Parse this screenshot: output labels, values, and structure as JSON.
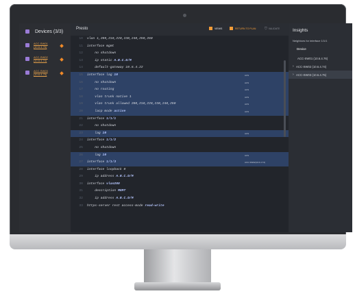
{
  "devices": {
    "title": "Devices (3/3)",
    "items": [
      {
        "name": "ACC-SW01",
        "ip": "(10.6.4.76)"
      },
      {
        "name": "ACC-SW02",
        "ip": "(10.6.4.74)"
      },
      {
        "name": "ACC-SW03",
        "ip": "(10.6.4.75)"
      }
    ]
  },
  "editor": {
    "title": "Presto",
    "views_label": "VIEWS",
    "return_label": "RETURN TO PLAN",
    "validate_label": "VALIDATE",
    "lines": [
      {
        "n": "10",
        "t": "vlan 1,209,210,220,230,240,250,260"
      },
      {
        "n": "11",
        "t": "interface mgmt"
      },
      {
        "n": "12",
        "t": "    no shutdown"
      },
      {
        "n": "13",
        "t": "    ip static ",
        "b": "A.B.C.D/M"
      },
      {
        "n": "14",
        "t": "    default-gateway 10.6.4.22"
      },
      {
        "n": "15",
        "t": "interface lag ",
        "b": "10",
        "hl": true,
        "a": "ACS"
      },
      {
        "n": "16",
        "t": "    no shutdown",
        "hl": true,
        "a": "ACS"
      },
      {
        "n": "17",
        "t": "    no routing",
        "hl": true,
        "a": "ACS"
      },
      {
        "n": "18",
        "t": "    vlan trunk native 1",
        "hl": true,
        "a": "ACS"
      },
      {
        "n": "19",
        "t": "    vlan trunk allowed 200,210,220,230,240,250",
        "hl": true,
        "a": "ACS"
      },
      {
        "n": "20",
        "t": "    lacp mode ",
        "b": "active",
        "hl": true,
        "a": "ACS"
      },
      {
        "n": "21",
        "t": "interface ",
        "b": "1/1/1"
      },
      {
        "n": "22",
        "t": "    no shutdown"
      },
      {
        "n": "23",
        "t": "    lag ",
        "b": "10",
        "hl": true,
        "a": "ACS"
      },
      {
        "n": "24",
        "t": "interface ",
        "b": "1/1/2"
      },
      {
        "n": "25",
        "t": "    no shutdown"
      },
      {
        "n": "26",
        "t": "    lag ",
        "b": "10",
        "hl": true,
        "a": "ACS"
      },
      {
        "n": "27",
        "t": "interface ",
        "b": "1/1/3",
        "hl": true,
        "a": "ACC-SW02(10.6.4.74)"
      },
      {
        "n": "28",
        "t": "interface loopback 0"
      },
      {
        "n": "29",
        "t": "    ip address ",
        "b": "A.B.C.D/M"
      },
      {
        "n": "30",
        "t": "interface ",
        "b": "vlan200"
      },
      {
        "n": "31",
        "t": "    description ",
        "b": "MGMT"
      },
      {
        "n": "32",
        "t": "    ip address ",
        "b": "A.B.C.D/M"
      },
      {
        "n": "33",
        "t": "https-server rest access-mode ",
        "b": "read-write"
      }
    ]
  },
  "insights": {
    "title": "Insights",
    "subtitle": "Neighbors for interface 1/1/1",
    "device_header": "Device",
    "rows": [
      {
        "label": "ACC-SW01 (10.6.4.76)",
        "chevron": false,
        "active": false
      },
      {
        "label": "ACC-SW02 (10.6.4.74)",
        "chevron": true,
        "active": false
      },
      {
        "label": "ACC-SW03 (10.6.4.75)",
        "chevron": true,
        "active": true
      }
    ]
  }
}
